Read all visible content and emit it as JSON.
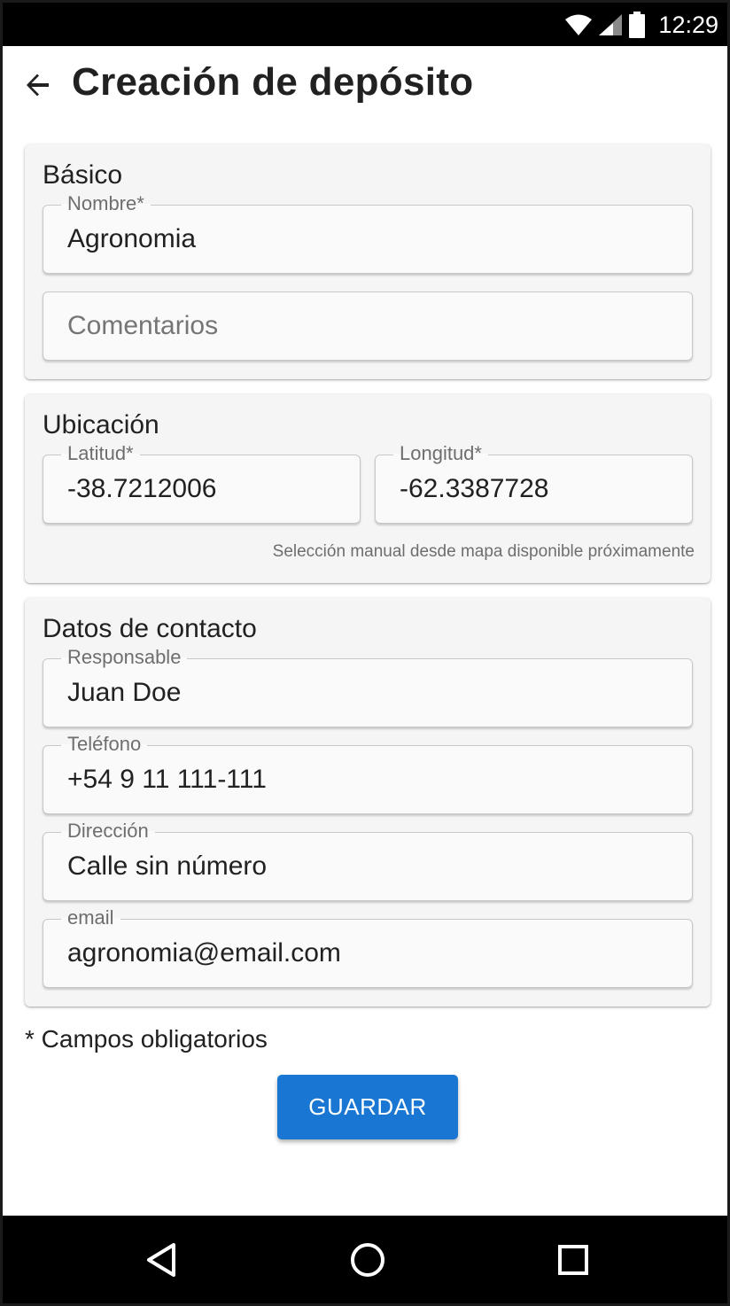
{
  "status_bar": {
    "time": "12:29",
    "icons": [
      "wifi-icon",
      "signal-icon",
      "battery-icon"
    ]
  },
  "header": {
    "back_icon": "arrow-left-icon",
    "title": "Creación de depósito"
  },
  "sections": {
    "basic": {
      "title": "Básico",
      "name_label": "Nombre*",
      "name_value": "Agronomia",
      "comments_placeholder": "Comentarios"
    },
    "location": {
      "title": "Ubicación",
      "latitude_label": "Latitud*",
      "latitude_value": "-38.7212006",
      "longitude_label": "Longitud*",
      "longitude_value": "-62.3387728",
      "hint": "Selección manual desde mapa disponible próximamente"
    },
    "contact": {
      "title": "Datos de contacto",
      "responsible_label": "Responsable",
      "responsible_value": "Juan Doe",
      "phone_label": "Teléfono",
      "phone_value": "+54 9 11 111-111",
      "address_label": "Dirección",
      "address_value": "Calle sin número",
      "email_label": "email",
      "email_value": "agronomia@email.com"
    }
  },
  "required_note": "* Campos obligatorios",
  "save_label": "GUARDAR",
  "colors": {
    "primary": "#1976d2",
    "card_background": "#f5f5f5",
    "status_bar": "#000000"
  },
  "navigation_bar": {
    "icons": [
      "back-triangle-icon",
      "home-circle-icon",
      "recents-square-icon"
    ]
  }
}
